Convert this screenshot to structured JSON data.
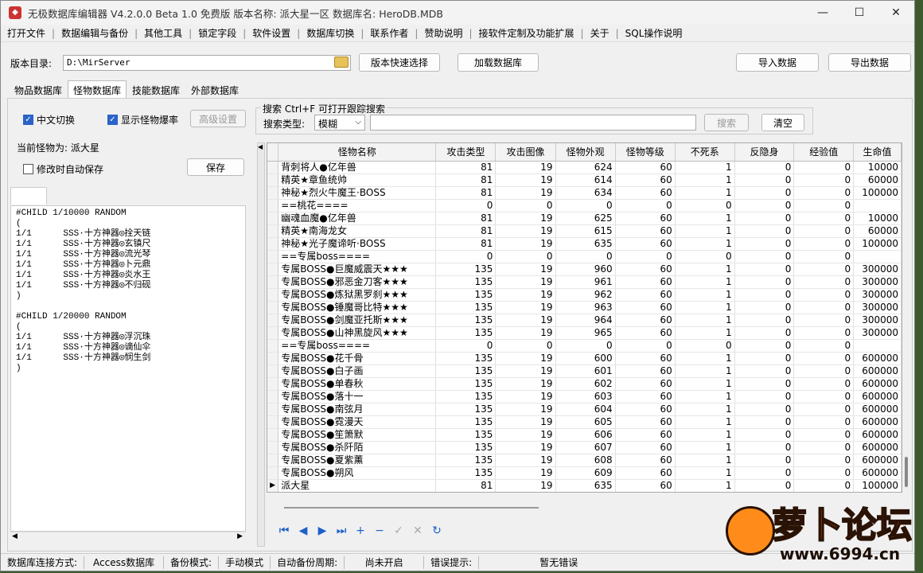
{
  "window": {
    "title": "无极数据库编辑器 V4.2.0.0    Beta 1.0 免费版    版本名称: 派大星一区    数据库名: HeroDB.MDB",
    "minimize_glyph": "—",
    "maximize_glyph": "☐",
    "close_glyph": "✕"
  },
  "menu": [
    "打开文件",
    "数据编辑与备份",
    "其他工具",
    "锁定字段",
    "软件设置",
    "数据库切换",
    "联系作者",
    "赞助说明",
    "接软件定制及功能扩展",
    "关于",
    "SQL操作说明"
  ],
  "toolbar": {
    "version_dir_label": "版本目录:",
    "version_dir_value": "D:\\MirServer",
    "quick_select": "版本快速选择",
    "load_db": "加载数据库",
    "import": "导入数据",
    "export": "导出数据"
  },
  "tabs": [
    {
      "label": "物品数据库",
      "active": false
    },
    {
      "label": "怪物数据库",
      "active": true
    },
    {
      "label": "技能数据库",
      "active": false
    },
    {
      "label": "外部数据库",
      "active": false
    }
  ],
  "options": {
    "cn_switch": "中文切换",
    "show_drop": "显示怪物爆率",
    "advanced": "高级设置"
  },
  "search": {
    "group_title": "搜索   Ctrl+F 可打开跟踪搜索",
    "type_label": "搜索类型:",
    "type_value": "模糊",
    "search_btn": "搜索",
    "clear_btn": "清空"
  },
  "left": {
    "current_monster": "当前怪物为: 派大星",
    "autosave": "修改时自动保存",
    "save": "保存",
    "drop_text": "#CHILD 1/10000 RANDOM\n(\n1/1      SSS·十方神器◎拴天链\n1/1      SSS·十方神器◎玄镇尺\n1/1      SSS·十方神器◎流光琴\n1/1      SSS·十方神器◎卜元鼎\n1/1      SSS·十方神器◎炎水王\n1/1      SSS·十方神器◎不归砚\n)\n\n#CHILD 1/20000 RANDOM\n(\n1/1      SSS·十方神器◎浮沉珠\n1/1      SSS·十方神器◎谪仙伞\n1/1      SSS·十方神器◎悯生剑\n)"
  },
  "grid": {
    "columns": [
      "怪物名称",
      "攻击类型",
      "攻击图像",
      "怪物外观",
      "怪物等级",
      "不死系",
      "反隐身",
      "经验值",
      "生命值"
    ],
    "rows": [
      [
        "背刺将人●亿年兽",
        "81",
        "19",
        "624",
        "60",
        "1",
        "0",
        "0",
        "10000"
      ],
      [
        "精英★章鱼统帅",
        "81",
        "19",
        "614",
        "60",
        "1",
        "0",
        "0",
        "60000"
      ],
      [
        "神秘★烈火牛魔王·BOSS",
        "81",
        "19",
        "634",
        "60",
        "1",
        "0",
        "0",
        "100000"
      ],
      [
        "==桃花====",
        "0",
        "0",
        "0",
        "0",
        "0",
        "0",
        "0",
        ""
      ],
      [
        "幽魂血魔●亿年兽",
        "81",
        "19",
        "625",
        "60",
        "1",
        "0",
        "0",
        "10000"
      ],
      [
        "精英★南海龙女",
        "81",
        "19",
        "615",
        "60",
        "1",
        "0",
        "0",
        "60000"
      ],
      [
        "神秘★光子魔谛听·BOSS",
        "81",
        "19",
        "635",
        "60",
        "1",
        "0",
        "0",
        "100000"
      ],
      [
        "==专属boss====",
        "0",
        "0",
        "0",
        "0",
        "0",
        "0",
        "0",
        ""
      ],
      [
        "专属BOSS●巨魔威震天★★★",
        "135",
        "19",
        "960",
        "60",
        "1",
        "0",
        "0",
        "300000"
      ],
      [
        "专属BOSS●邪恶金刀客★★★",
        "135",
        "19",
        "961",
        "60",
        "1",
        "0",
        "0",
        "300000"
      ],
      [
        "专属BOSS●炼狱黑罗刹★★★",
        "135",
        "19",
        "962",
        "60",
        "1",
        "0",
        "0",
        "300000"
      ],
      [
        "专属BOSS●锤魔哥比特★★★",
        "135",
        "19",
        "963",
        "60",
        "1",
        "0",
        "0",
        "300000"
      ],
      [
        "专属BOSS●剑魔亚托斯★★★",
        "135",
        "19",
        "964",
        "60",
        "1",
        "0",
        "0",
        "300000"
      ],
      [
        "专属BOSS●山神黑旋风★★★",
        "135",
        "19",
        "965",
        "60",
        "1",
        "0",
        "0",
        "300000"
      ],
      [
        "==专属boss====",
        "0",
        "0",
        "0",
        "0",
        "0",
        "0",
        "0",
        ""
      ],
      [
        "专属BOSS●花千骨",
        "135",
        "19",
        "600",
        "60",
        "1",
        "0",
        "0",
        "600000"
      ],
      [
        "专属BOSS●白子画",
        "135",
        "19",
        "601",
        "60",
        "1",
        "0",
        "0",
        "600000"
      ],
      [
        "专属BOSS●单春秋",
        "135",
        "19",
        "602",
        "60",
        "1",
        "0",
        "0",
        "600000"
      ],
      [
        "专属BOSS●落十一",
        "135",
        "19",
        "603",
        "60",
        "1",
        "0",
        "0",
        "600000"
      ],
      [
        "专属BOSS●南弦月",
        "135",
        "19",
        "604",
        "60",
        "1",
        "0",
        "0",
        "600000"
      ],
      [
        "专属BOSS●霓漫天",
        "135",
        "19",
        "605",
        "60",
        "1",
        "0",
        "0",
        "600000"
      ],
      [
        "专属BOSS●笙箫默",
        "135",
        "19",
        "606",
        "60",
        "1",
        "0",
        "0",
        "600000"
      ],
      [
        "专属BOSS●杀阡陌",
        "135",
        "19",
        "607",
        "60",
        "1",
        "0",
        "0",
        "600000"
      ],
      [
        "专属BOSS●夏紫薰",
        "135",
        "19",
        "608",
        "60",
        "1",
        "0",
        "0",
        "600000"
      ],
      [
        "专属BOSS●朔风",
        "135",
        "19",
        "609",
        "60",
        "1",
        "0",
        "0",
        "600000"
      ],
      [
        "派大星",
        "81",
        "19",
        "635",
        "60",
        "1",
        "0",
        "0",
        "100000"
      ]
    ],
    "current_row_index": 25
  },
  "navigator": [
    "⏮",
    "◀",
    "▶",
    "⏭",
    "+",
    "−",
    "✓",
    "✕",
    "↻"
  ],
  "status": {
    "conn_label": "数据库连接方式:",
    "conn_value": "Access数据库",
    "backup_label": "备份模式:",
    "backup_value": "手动模式",
    "autobackup_label": "自动备份周期:",
    "autobackup_value": "尚未开启",
    "error_label": "错误提示:",
    "error_value": "暂无错误"
  },
  "watermark": {
    "text": "萝卜论坛",
    "url": "www.6994.cn"
  }
}
